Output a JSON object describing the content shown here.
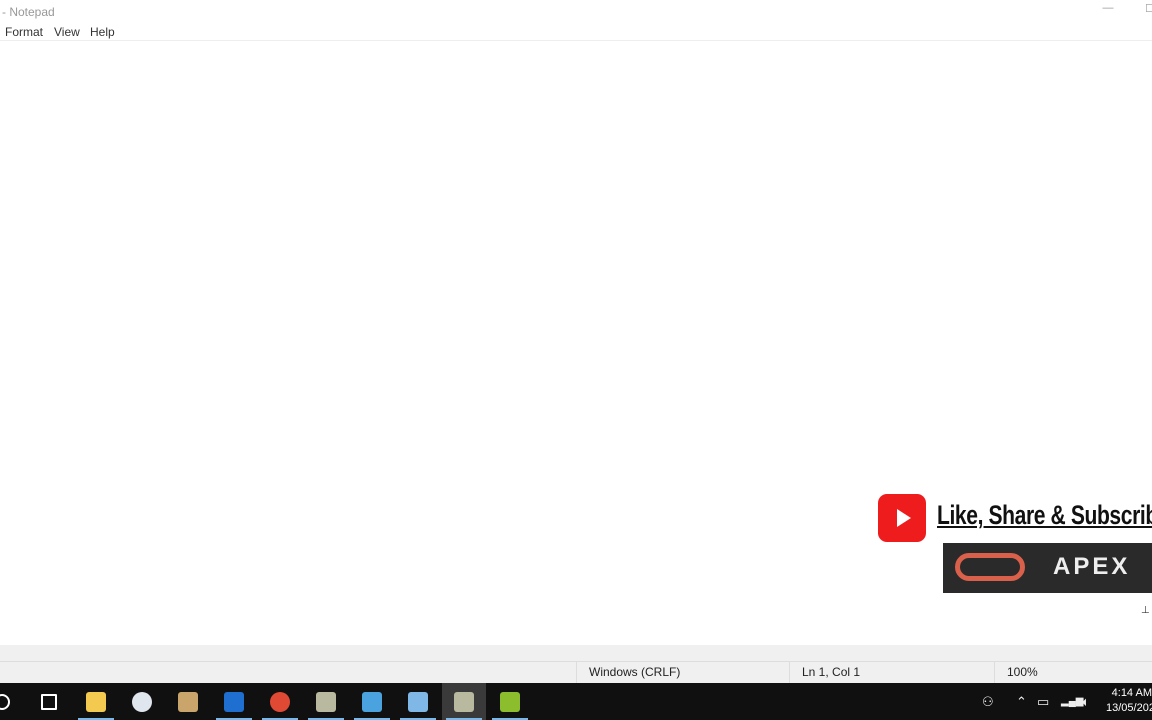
{
  "window": {
    "title": "- Notepad",
    "minimize": "—",
    "maximize": "☐"
  },
  "menu": {
    "items": [
      "Format",
      "View",
      "Help"
    ]
  },
  "editor": {
    "content": ""
  },
  "watermark": {
    "subscribe_text": "Like, Share & Subscrib",
    "brand_text": "APEX",
    "youtube_color": "#ee1c1c",
    "ring_color": "#d9604a",
    "cursor_glyph": "⊥"
  },
  "status": {
    "line_ending": "Windows (CRLF)",
    "position": "Ln 1, Col 1",
    "zoom": "100%"
  },
  "taskbar": {
    "apps": [
      {
        "name": "search-icon",
        "color": "#ffffff",
        "open": false
      },
      {
        "name": "task-view-icon",
        "color": "#ffffff",
        "open": false
      },
      {
        "name": "file-explorer-icon",
        "color": "#f3c94f",
        "open": true
      },
      {
        "name": "settings-gear-icon",
        "color": "#dfe6ee",
        "open": false
      },
      {
        "name": "tomcat-icon",
        "color": "#c9a46b",
        "open": false
      },
      {
        "name": "4g-app-icon",
        "color": "#1e6fd0",
        "open": true
      },
      {
        "name": "chrome-icon",
        "color": "#e04a35",
        "open": true
      },
      {
        "name": "sql-tool-icon",
        "color": "#b9b9a0",
        "open": true
      },
      {
        "name": "media-app-icon",
        "color": "#4aa3df",
        "open": true
      },
      {
        "name": "notepad-icon",
        "color": "#7fb7e6",
        "open": true
      },
      {
        "name": "sql-tool-error-icon",
        "color": "#b9b9a0",
        "open": true,
        "active": true
      },
      {
        "name": "toad-icon",
        "color": "#8bbd2d",
        "open": true
      }
    ],
    "tray": {
      "time": "4:14 AM",
      "date": "13/05/202"
    }
  }
}
